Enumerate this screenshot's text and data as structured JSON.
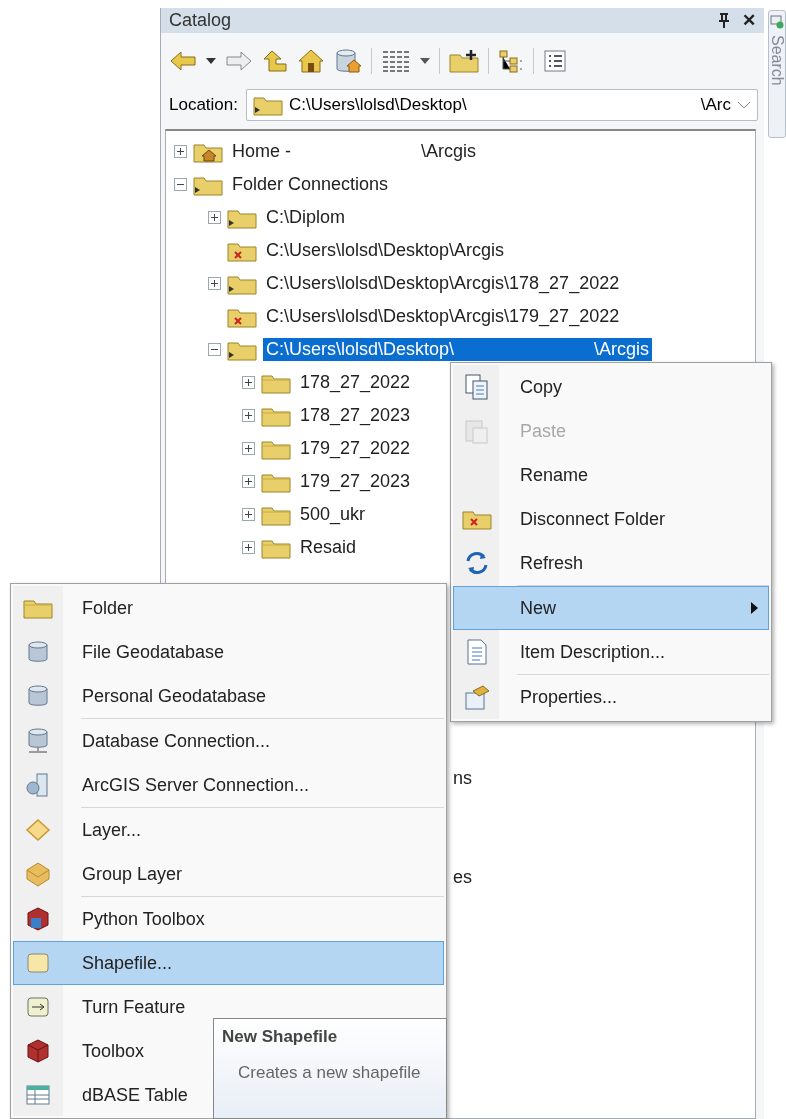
{
  "panel": {
    "title": "Catalog",
    "close": "✕",
    "side_tab": "Search"
  },
  "location": {
    "label": "Location:",
    "value": "C:\\Users\\lolsd\\Desktop\\",
    "value_end": "\\Arc"
  },
  "tree": [
    {
      "kind": "home",
      "expanded": false,
      "selected": false,
      "label": "Home -",
      "label_end": "\\Arcgis"
    },
    {
      "kind": "connection",
      "expanded": true,
      "selected": false,
      "label": "Folder Connections",
      "children": [
        {
          "kind": "connection",
          "expanded": false,
          "selected": false,
          "label": "C:\\Diplom"
        },
        {
          "kind": "broken",
          "selected": false,
          "label": "C:\\Users\\lolsd\\Desktop\\Arcgis"
        },
        {
          "kind": "connection",
          "expanded": false,
          "selected": false,
          "label": "C:\\Users\\lolsd\\Desktop\\Arcgis\\178_27_2022"
        },
        {
          "kind": "broken",
          "selected": false,
          "label": "C:\\Users\\lolsd\\Desktop\\Arcgis\\179_27_2022"
        },
        {
          "kind": "connection",
          "expanded": true,
          "selected": true,
          "label": "C:\\Users\\lolsd\\Desktop\\",
          "label_end": "\\Arcgis",
          "children": [
            {
              "kind": "folder",
              "expanded": false,
              "selected": false,
              "label": "178_27_2022"
            },
            {
              "kind": "folder",
              "expanded": false,
              "selected": false,
              "label": "178_27_2023"
            },
            {
              "kind": "folder",
              "expanded": false,
              "selected": false,
              "label": "179_27_2022"
            },
            {
              "kind": "folder",
              "expanded": false,
              "selected": false,
              "label": "179_27_2023"
            },
            {
              "kind": "folder",
              "expanded": false,
              "selected": false,
              "label": "500_ukr"
            },
            {
              "kind": "folder",
              "expanded": false,
              "selected": false,
              "label": "Resaid"
            }
          ]
        }
      ]
    }
  ],
  "tree_fragments": [
    "ns",
    "es"
  ],
  "context_menu": [
    {
      "kind": "copy",
      "label": "Copy",
      "disabled": false,
      "selected": false,
      "submenu": false
    },
    {
      "kind": "paste",
      "label": "Paste",
      "disabled": true,
      "selected": false,
      "submenu": false
    },
    {
      "kind": "plain",
      "label": "Rename",
      "disabled": false,
      "selected": false,
      "submenu": false
    },
    {
      "kind": "disconnect",
      "label": "Disconnect Folder",
      "disabled": false,
      "selected": false,
      "submenu": false
    },
    {
      "kind": "refresh",
      "label": "Refresh",
      "disabled": false,
      "selected": false,
      "submenu": false
    },
    {
      "kind": "plain",
      "label": "New",
      "disabled": false,
      "selected": true,
      "submenu": true
    },
    {
      "kind": "document",
      "label": "Item Description...",
      "disabled": false,
      "selected": false,
      "submenu": false
    },
    {
      "kind": "properties",
      "label": "Properties...",
      "disabled": false,
      "selected": false,
      "submenu": false
    }
  ],
  "new_submenu": [
    {
      "kind": "folder",
      "label": "Folder",
      "selected": false
    },
    {
      "kind": "database",
      "label": "File Geodatabase",
      "selected": false
    },
    {
      "kind": "database",
      "label": "Personal Geodatabase",
      "selected": false
    },
    {
      "kind": "db-connection",
      "label": "Database Connection...",
      "selected": false
    },
    {
      "kind": "server",
      "label": "ArcGIS Server Connection...",
      "selected": false
    },
    {
      "kind": "layer",
      "label": "Layer...",
      "selected": false
    },
    {
      "kind": "group-layer",
      "label": "Group Layer",
      "selected": false
    },
    {
      "kind": "python-toolbox",
      "label": "Python Toolbox",
      "selected": false
    },
    {
      "kind": "shapefile",
      "label": "Shapefile...",
      "selected": true
    },
    {
      "kind": "feature-class",
      "label": "Turn Feature",
      "selected": false
    },
    {
      "kind": "toolbox",
      "label": "Toolbox",
      "selected": false
    },
    {
      "kind": "table",
      "label": "dBASE Table",
      "selected": false
    }
  ],
  "tooltip": {
    "title": "New Shapefile",
    "text": "Creates a new shapefile"
  }
}
